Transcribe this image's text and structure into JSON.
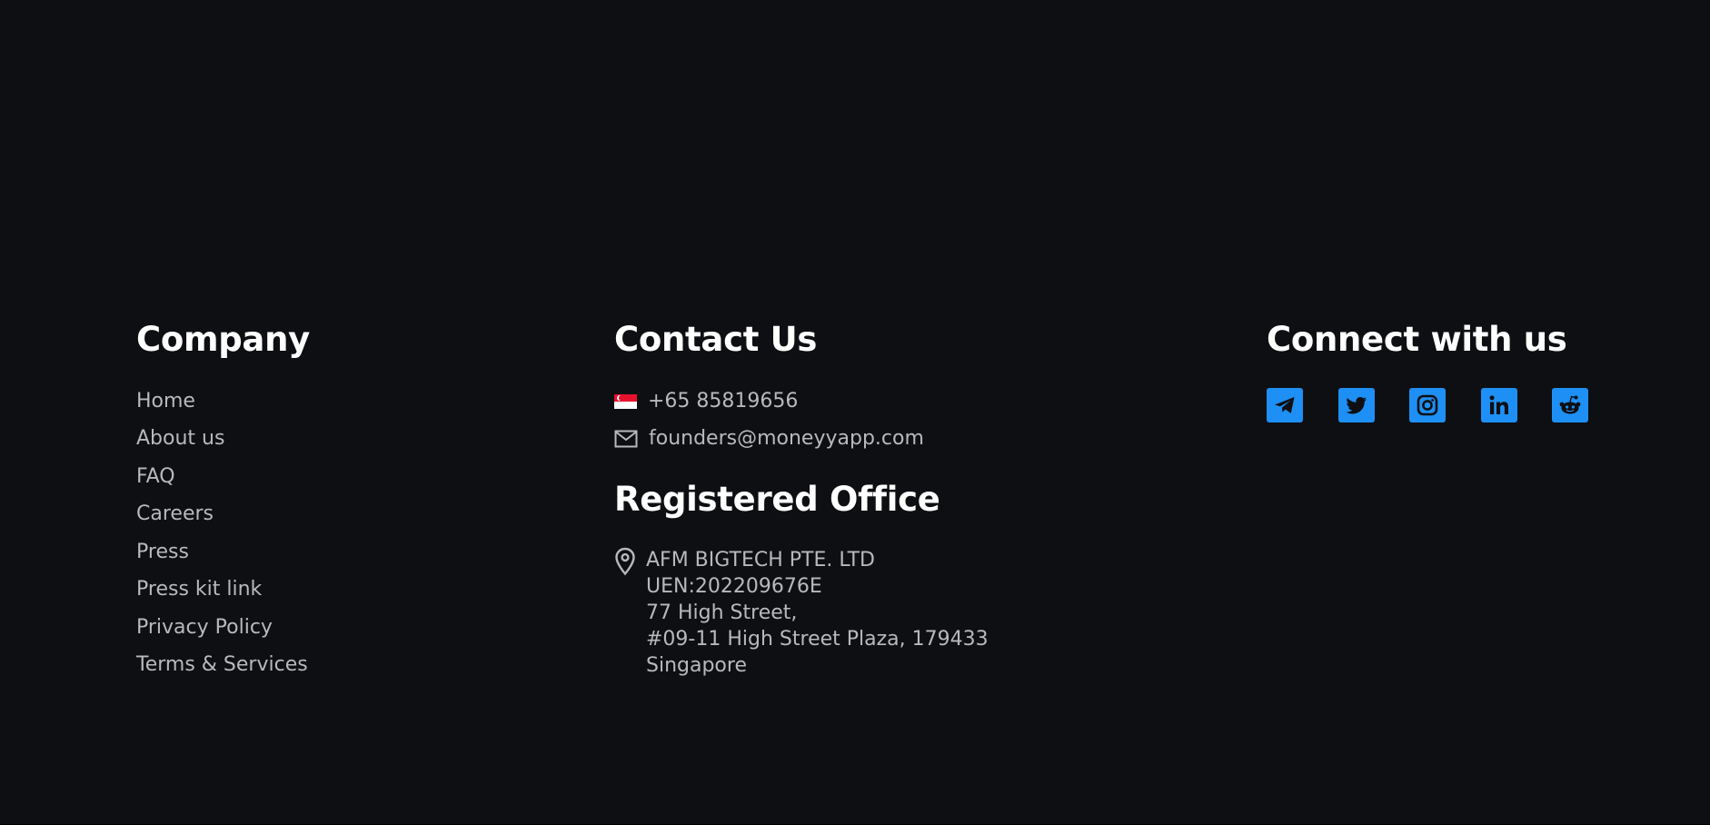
{
  "company": {
    "heading": "Company",
    "links": [
      {
        "label": "Home"
      },
      {
        "label": "About us"
      },
      {
        "label": "FAQ"
      },
      {
        "label": "Careers"
      },
      {
        "label": "Press"
      },
      {
        "label": "Press kit link"
      },
      {
        "label": "Privacy Policy"
      },
      {
        "label": "Terms & Services"
      }
    ]
  },
  "contact": {
    "heading": "Contact Us",
    "phone": {
      "icon": "singapore-flag-icon",
      "text": "+65 85819656"
    },
    "email": {
      "icon": "mail-icon",
      "text": "founders@moneyyapp.com"
    }
  },
  "office": {
    "heading": "Registered Office",
    "icon": "location-pin-icon",
    "lines": [
      "AFM BIGTECH PTE. LTD",
      "UEN:202209676E",
      "77 High Street,",
      "#09-11 High Street Plaza, 179433",
      "Singapore"
    ]
  },
  "connect": {
    "heading": "Connect with us",
    "socials": [
      {
        "name": "telegram-icon"
      },
      {
        "name": "twitter-icon"
      },
      {
        "name": "instagram-icon"
      },
      {
        "name": "linkedin-icon"
      },
      {
        "name": "reddit-icon"
      }
    ]
  },
  "colors": {
    "background": "#0d0f12",
    "heading": "#ffffff",
    "text": "#b7b9bd",
    "accent": "#1e90f5"
  }
}
